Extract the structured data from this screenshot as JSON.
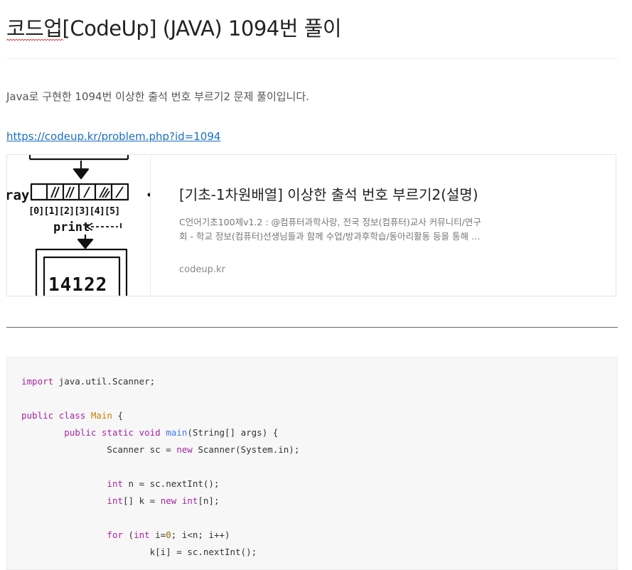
{
  "post": {
    "title": "코드업[CodeUp] (JAVA) 1094번 풀이",
    "intro": "Java로 구현한 1094번 이상한 출석 번호 부르기2 문제 풀이입니다.",
    "link_url": "https://codeup.kr/problem.php?id=1094"
  },
  "og_card": {
    "title": "[기초-1차원배열] 이상한 출석 번호 부르기2(설명)",
    "desc_line1": "C언어기초100제v1.2 : @컴퓨터과학사랑, 전국 정보(컴퓨터)교사 커뮤니티/연구",
    "desc_line2": "회 - 학교 정보(컴퓨터)선생님들과 함께 수업/방과후학습/동아리활동 등을 통해 …",
    "site": "codeup.kr",
    "thumb": {
      "array_label": "ray",
      "indices": "[0][1][2][3][4][5]",
      "print_label": "print",
      "output_value": "14122"
    }
  },
  "colors": {
    "keyword": "#a626a4",
    "class_name": "#c18401",
    "function": "#4078f2",
    "number": "#986801",
    "link": "#1a6fc2"
  },
  "code": {
    "lines": [
      [
        {
          "t": "import",
          "c": "kw"
        },
        {
          "t": " java.util.Scanner;"
        }
      ],
      [],
      [
        {
          "t": "public",
          "c": "kw"
        },
        {
          "t": " "
        },
        {
          "t": "class",
          "c": "kw"
        },
        {
          "t": " "
        },
        {
          "t": "Main",
          "c": "cls"
        },
        {
          "t": " {"
        }
      ],
      [
        {
          "t": "        "
        },
        {
          "t": "public",
          "c": "kw"
        },
        {
          "t": " "
        },
        {
          "t": "static",
          "c": "kw"
        },
        {
          "t": " "
        },
        {
          "t": "void",
          "c": "kw"
        },
        {
          "t": " "
        },
        {
          "t": "main",
          "c": "fn"
        },
        {
          "t": "(String[] args) {"
        }
      ],
      [
        {
          "t": "                Scanner sc = "
        },
        {
          "t": "new",
          "c": "kw"
        },
        {
          "t": " Scanner(System.in);"
        }
      ],
      [],
      [
        {
          "t": "                "
        },
        {
          "t": "int",
          "c": "kw"
        },
        {
          "t": " n = sc.nextInt();"
        }
      ],
      [
        {
          "t": "                "
        },
        {
          "t": "int",
          "c": "kw"
        },
        {
          "t": "[] k = "
        },
        {
          "t": "new",
          "c": "kw"
        },
        {
          "t": " "
        },
        {
          "t": "int",
          "c": "kw"
        },
        {
          "t": "[n];"
        }
      ],
      [],
      [
        {
          "t": "                "
        },
        {
          "t": "for",
          "c": "kw"
        },
        {
          "t": " ("
        },
        {
          "t": "int",
          "c": "kw"
        },
        {
          "t": " i="
        },
        {
          "t": "0",
          "c": "num"
        },
        {
          "t": "; i<n; i++)"
        }
      ],
      [
        {
          "t": "                        k[i] = sc.nextInt();"
        }
      ]
    ]
  }
}
